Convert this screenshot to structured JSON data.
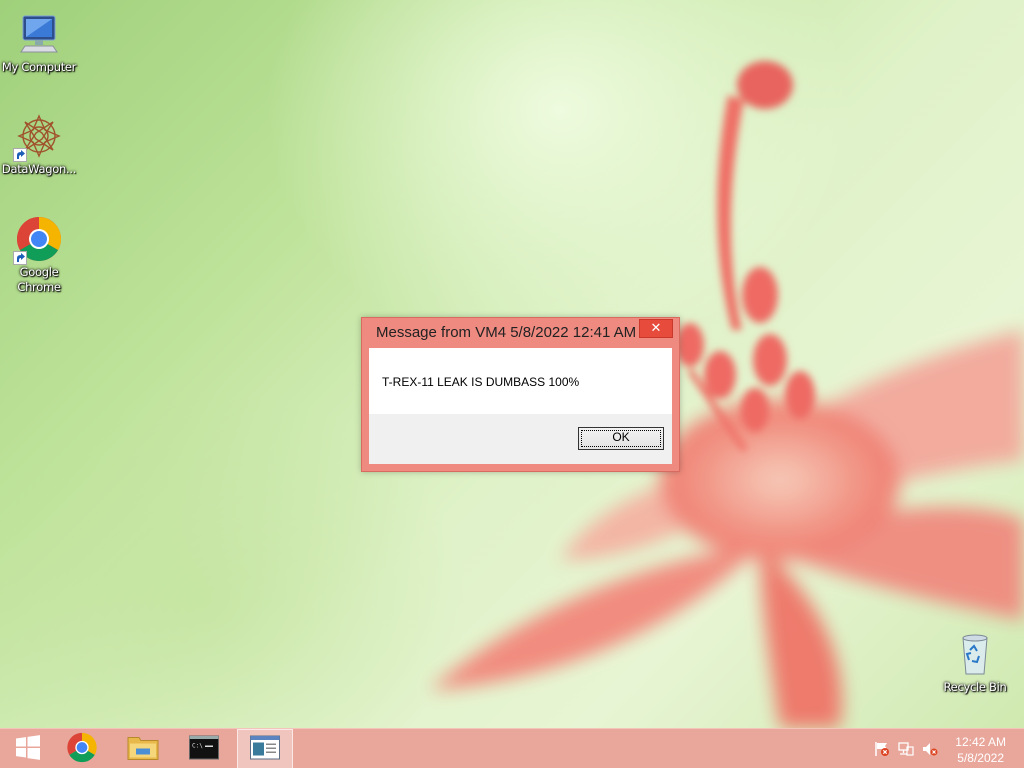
{
  "desktop": {
    "icons": [
      {
        "label": "My Computer",
        "icon": "computer-icon"
      },
      {
        "label": "DataWagon...",
        "icon": "datawagon-icon"
      },
      {
        "label": "Google Chrome",
        "icon": "chrome-icon"
      },
      {
        "label": "Recycle Bin",
        "icon": "recycle-bin-icon"
      }
    ]
  },
  "dialog": {
    "title": "Message from VM4 5/8/2022 12:41 AM",
    "close_glyph": "✕",
    "message": "T-REX-11 LEAK IS DUMBASS 100%",
    "ok_label": "OK"
  },
  "taskbar": {
    "buttons": [
      {
        "icon": "windows-start-icon"
      },
      {
        "icon": "chrome-icon"
      },
      {
        "icon": "file-explorer-icon"
      },
      {
        "icon": "command-prompt-icon"
      },
      {
        "icon": "message-window-icon",
        "active": true
      }
    ],
    "tray": [
      {
        "icon": "action-center-flag-icon"
      },
      {
        "icon": "network-icon"
      },
      {
        "icon": "volume-muted-icon"
      }
    ],
    "clock": {
      "time": "12:42 AM",
      "date": "5/8/2022"
    }
  },
  "colors": {
    "taskbar": "#e9a79c",
    "dialog_frame": "#ee8a80",
    "close_button": "#e64b3c",
    "flower": "#f07a70"
  }
}
